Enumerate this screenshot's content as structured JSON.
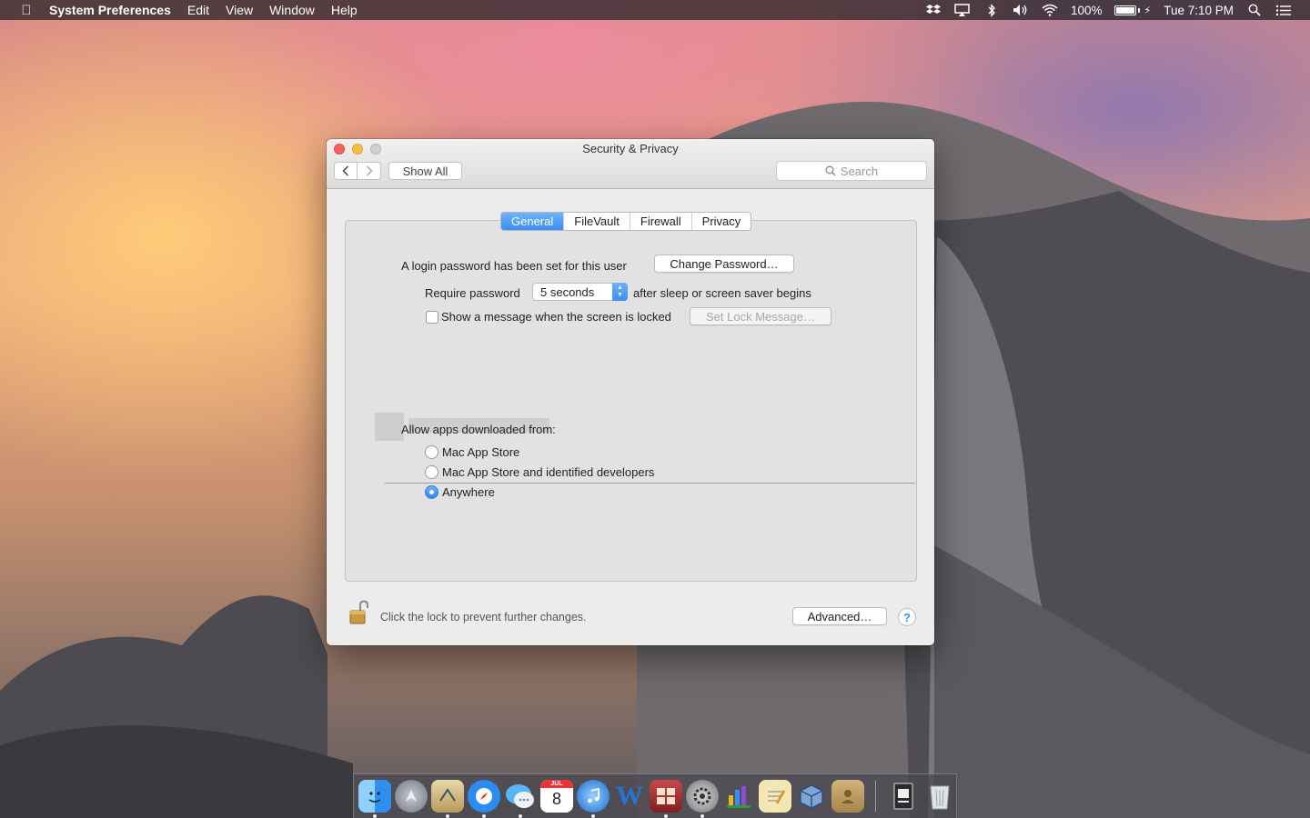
{
  "menubar": {
    "app_name": "System Preferences",
    "menus": [
      "Edit",
      "View",
      "Window",
      "Help"
    ],
    "battery": "100%",
    "clock": "Tue 7:10 PM"
  },
  "window": {
    "title": "Security & Privacy",
    "show_all": "Show All",
    "search_placeholder": "Search",
    "tabs": [
      {
        "label": "General",
        "active": true
      },
      {
        "label": "FileVault",
        "active": false
      },
      {
        "label": "Firewall",
        "active": false
      },
      {
        "label": "Privacy",
        "active": false
      }
    ],
    "general": {
      "login_text": "A login password has been set for this user",
      "change_password": "Change Password…",
      "require_label": "Require password",
      "require_value": "5 seconds",
      "require_suffix": "after sleep or screen saver begins",
      "show_message_label": "Show a message when the screen is locked",
      "show_message_checked": false,
      "set_lock_message": "Set Lock Message…",
      "allow_apps_label": "Allow apps downloaded from:",
      "allow_options": [
        {
          "label": "Mac App Store",
          "selected": false
        },
        {
          "label": "Mac App Store and identified developers",
          "selected": false
        },
        {
          "label": "Anywhere",
          "selected": true
        }
      ]
    },
    "footer": {
      "lock_text": "Click the lock to prevent further changes.",
      "advanced": "Advanced…",
      "help": "?"
    }
  },
  "dock": {
    "calendar_month": "JUL",
    "calendar_day": "8"
  },
  "colors": {
    "accent": "#3a8df5",
    "window_bg": "#ececec",
    "close": "#fc605c",
    "minimize": "#fdbc40"
  }
}
